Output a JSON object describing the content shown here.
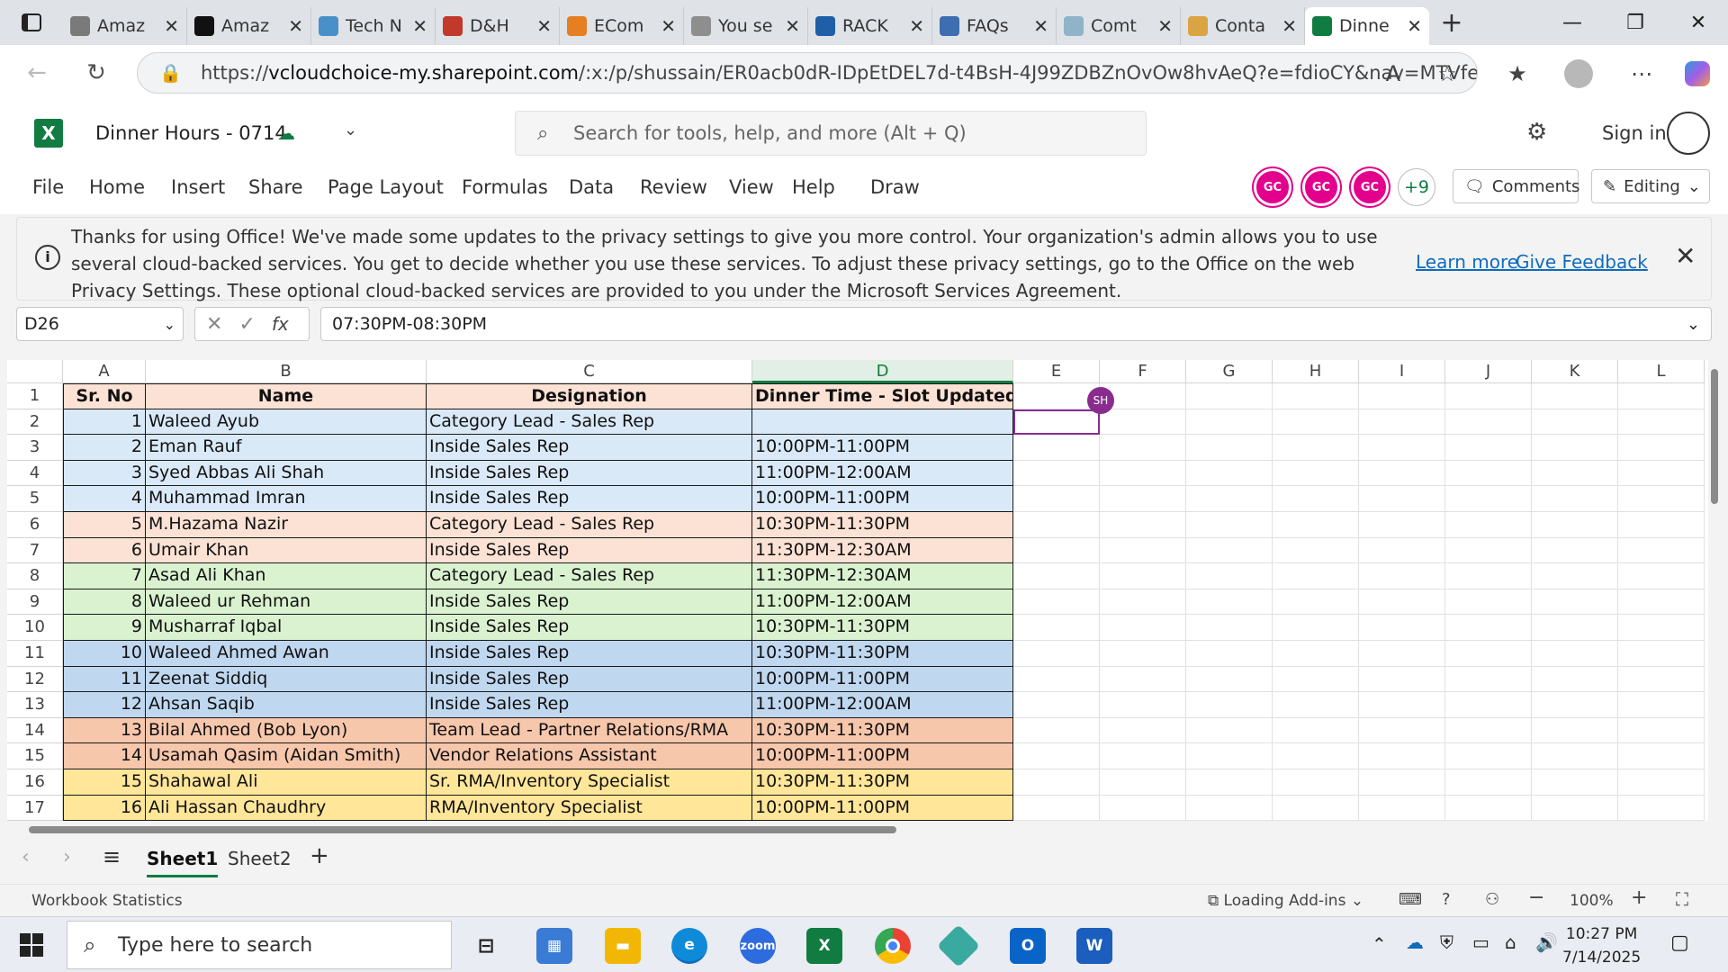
{
  "browser": {
    "tabs": [
      {
        "label": "Amaz",
        "color": "#7a7a7a",
        "glyph": "a"
      },
      {
        "label": "Amaz",
        "color": "#111111",
        "glyph": "a"
      },
      {
        "label": "Tech N",
        "color": "#4a90c8",
        "glyph": "T"
      },
      {
        "label": "D&H",
        "color": "#c0392b",
        "glyph": "D"
      },
      {
        "label": "ECom",
        "color": "#e67e22",
        "glyph": "S"
      },
      {
        "label": "You se",
        "color": "#8e8e8e",
        "glyph": "Y"
      },
      {
        "label": "RACK",
        "color": "#1f5fa8",
        "glyph": "R"
      },
      {
        "label": "FAQs",
        "color": "#3d6eb0",
        "glyph": "E"
      },
      {
        "label": "Comt",
        "color": "#8fb4c9",
        "glyph": "C"
      },
      {
        "label": "Conta",
        "color": "#d9a441",
        "glyph": "C"
      },
      {
        "label": "Dinne",
        "color": "#107c41",
        "glyph": "X",
        "active": true
      }
    ],
    "url_prefix": "https://",
    "url_domain": "vcloudchoice-my.sharepoint.com",
    "url_rest": "/:x:/p/shussain/ER0acb0dR-IDpEtDEL7d-t4BsH-4J99ZDBZnOvOw8hvAeQ?e=fdioCY&nav=MTVfe..."
  },
  "app": {
    "doc_title": "Dinner Hours - 0714",
    "search_placeholder": "Search for tools, help, and more (Alt + Q)",
    "sign_in": "Sign in",
    "menu": [
      "File",
      "Home",
      "Insert",
      "Share",
      "Page Layout",
      "Formulas",
      "Data",
      "Review",
      "View",
      "Help",
      "Draw"
    ],
    "collaborators": [
      "GC",
      "GC",
      "GC"
    ],
    "more_collaborators": "+9",
    "comments_label": "Comments",
    "editing_label": "Editing",
    "accent": "#107c41",
    "collab_color": "#e3008c"
  },
  "banner": {
    "text": "Thanks for using Office! We've made some updates to the privacy settings to give you more control. Your organization's admin allows you to use several cloud-backed services. You get to decide whether you use these services. To adjust these privacy settings, go to the Office on the web Privacy Settings. These optional cloud-backed services are provided to you under the Microsoft Services Agreement.",
    "learn_more": "Learn more",
    "give_feedback": "Give Feedback"
  },
  "formula_bar": {
    "name_box": "D26",
    "formula": "07:30PM-08:30PM"
  },
  "sheet": {
    "columns": [
      "A",
      "B",
      "C",
      "D",
      "E",
      "F",
      "G",
      "H",
      "I",
      "J",
      "K",
      "L"
    ],
    "selected_column": "D",
    "headers": [
      "Sr. No",
      "Name",
      "Designation",
      "Dinner Time - Slot Updated"
    ],
    "header_color": "#fbe2d5",
    "rows": [
      {
        "sr": "1",
        "name": "Waleed Ayub",
        "designation": "Category Lead - Sales Rep",
        "time": "",
        "color": "#dae9f8"
      },
      {
        "sr": "2",
        "name": "Eman Rauf",
        "designation": "Inside Sales Rep",
        "time": "10:00PM-11:00PM",
        "color": "#dae9f8"
      },
      {
        "sr": "3",
        "name": "Syed Abbas Ali Shah",
        "designation": "Inside Sales Rep",
        "time": "11:00PM-12:00AM",
        "color": "#dae9f8"
      },
      {
        "sr": "4",
        "name": "Muhammad Imran",
        "designation": "Inside Sales Rep",
        "time": "10:00PM-11:00PM",
        "color": "#dae9f8"
      },
      {
        "sr": "5",
        "name": "M.Hazama Nazir",
        "designation": "Category Lead - Sales Rep",
        "time": "10:30PM-11:30PM",
        "color": "#fbe2d5"
      },
      {
        "sr": "6",
        "name": "Umair Khan",
        "designation": "Inside Sales Rep",
        "time": "11:30PM-12:30AM",
        "color": "#fbe2d5"
      },
      {
        "sr": "7",
        "name": "Asad Ali Khan",
        "designation": "Category Lead - Sales Rep",
        "time": "11:30PM-12:30AM",
        "color": "#daf2d0"
      },
      {
        "sr": "8",
        "name": "Waleed ur Rehman",
        "designation": "Inside Sales Rep",
        "time": "11:00PM-12:00AM",
        "color": "#daf2d0"
      },
      {
        "sr": "9",
        "name": "Musharraf Iqbal",
        "designation": "Inside Sales Rep",
        "time": "10:30PM-11:30PM",
        "color": "#daf2d0"
      },
      {
        "sr": "10",
        "name": "Waleed Ahmed Awan",
        "designation": "Inside Sales Rep",
        "time": "10:30PM-11:30PM",
        "color": "#c0d7f0"
      },
      {
        "sr": "11",
        "name": "Zeenat Siddiq",
        "designation": "Inside Sales Rep",
        "time": "10:00PM-11:00PM",
        "color": "#c0d7f0"
      },
      {
        "sr": "12",
        "name": "Ahsan Saqib",
        "designation": "Inside Sales Rep",
        "time": "11:00PM-12:00AM",
        "color": "#c0d7f0"
      },
      {
        "sr": "13",
        "name": "Bilal Ahmed (Bob Lyon)",
        "designation": "Team Lead - Partner Relations/RMA",
        "time": "10:30PM-11:30PM",
        "color": "#f7c7ac"
      },
      {
        "sr": "14",
        "name": "Usamah Qasim (Aidan Smith)",
        "designation": "Vendor Relations Assistant",
        "time": "10:00PM-11:00PM",
        "color": "#f7c7ac"
      },
      {
        "sr": "15",
        "name": "Shahawal Ali",
        "designation": "Sr. RMA/Inventory Specialist",
        "time": "10:30PM-11:30PM",
        "color": "#ffe699"
      },
      {
        "sr": "16",
        "name": "Ali Hassan Chaudhry",
        "designation": "RMA/Inventory Specialist",
        "time": "10:00PM-11:00PM",
        "color": "#ffe699"
      }
    ],
    "presence_badge": "SH",
    "sheet_tabs": [
      "Sheet1",
      "Sheet2"
    ]
  },
  "status": {
    "left": "Workbook Statistics",
    "loading": "Loading Add-ins",
    "zoom": "100%"
  },
  "taskbar": {
    "search_placeholder": "Type here to search",
    "time": "10:27 PM",
    "date": "7/14/2025"
  }
}
